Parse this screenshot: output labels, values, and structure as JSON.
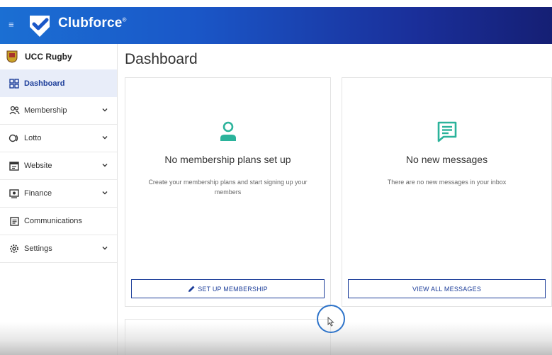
{
  "header": {
    "brand_name": "Clubforce",
    "brand_mark": "®",
    "menu_icon": "menu-collapse-icon"
  },
  "sidebar": {
    "club_name": "UCC Rugby",
    "items": [
      {
        "label": "Dashboard",
        "icon": "dashboard-icon",
        "active": true,
        "expandable": false
      },
      {
        "label": "Membership",
        "icon": "members-icon",
        "active": false,
        "expandable": true
      },
      {
        "label": "Lotto",
        "icon": "lotto-icon",
        "active": false,
        "expandable": true
      },
      {
        "label": "Website",
        "icon": "website-icon",
        "active": false,
        "expandable": true
      },
      {
        "label": "Finance",
        "icon": "finance-icon",
        "active": false,
        "expandable": true
      },
      {
        "label": "Communications",
        "icon": "communications-icon",
        "active": false,
        "expandable": false
      },
      {
        "label": "Settings",
        "icon": "settings-icon",
        "active": false,
        "expandable": true
      }
    ]
  },
  "main": {
    "page_title": "Dashboard",
    "cards": [
      {
        "title": "No membership plans set up",
        "description": "Create your membership plans and start signing up your members",
        "button_label": "SET UP MEMBERSHIP",
        "icon": "person-icon"
      },
      {
        "title": "No new messages",
        "description": "There are no new messages in your inbox",
        "button_label": "VIEW ALL MESSAGES",
        "icon": "message-icon"
      }
    ]
  },
  "colors": {
    "brand_blue": "#1d3e9a",
    "accent_teal": "#2bb39b",
    "active_bg": "#e8edf9"
  }
}
